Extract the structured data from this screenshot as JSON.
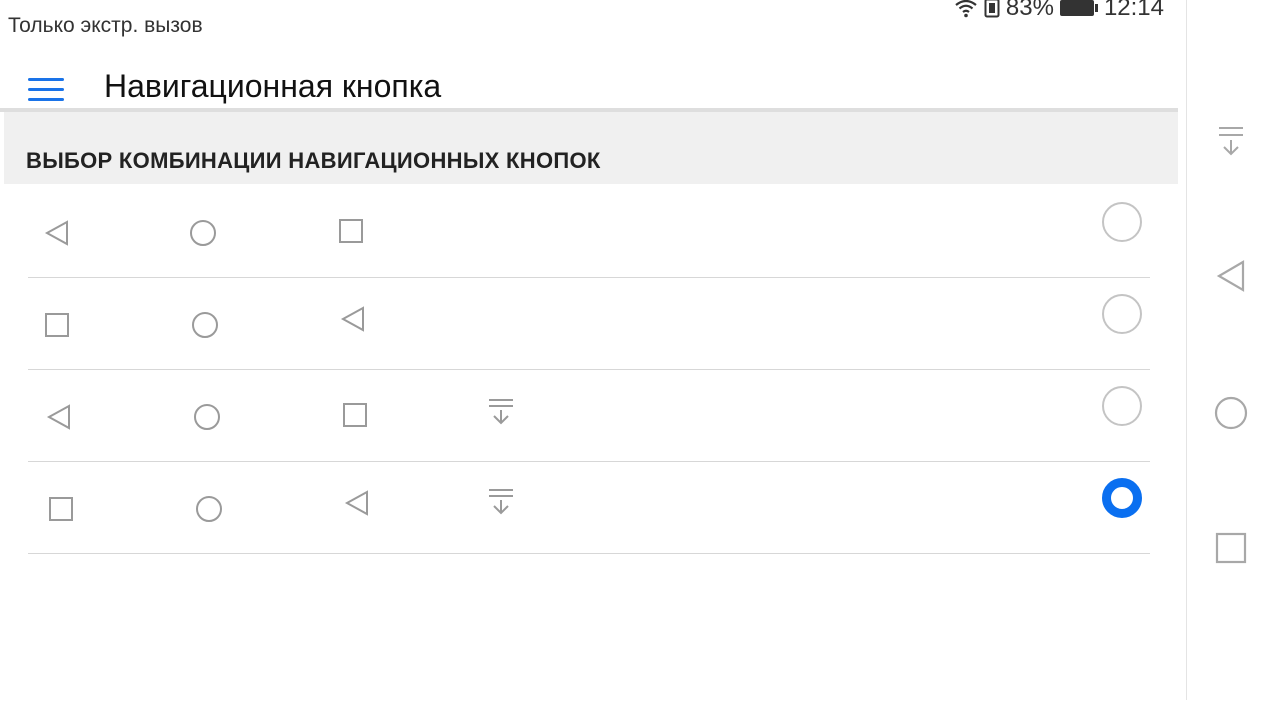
{
  "status_bar": {
    "carrier_text": "Только экстр. вызов",
    "battery_percent": "83%",
    "time": "12:14",
    "icons": [
      "wifi-icon",
      "sim-icon",
      "battery-icon"
    ]
  },
  "header": {
    "menu_icon": "hamburger-menu-icon",
    "title": "Навигационная кнопка"
  },
  "section": {
    "title": "ВЫБОР КОМБИНАЦИИ НАВИГАЦИОННЫХ КНОПОК"
  },
  "options": [
    {
      "buttons": [
        "back",
        "home",
        "recent"
      ],
      "selected": false
    },
    {
      "buttons": [
        "recent",
        "home",
        "back"
      ],
      "selected": false
    },
    {
      "buttons": [
        "back",
        "home",
        "recent",
        "notifications"
      ],
      "selected": false
    },
    {
      "buttons": [
        "recent",
        "home",
        "back",
        "notifications"
      ],
      "selected": true
    }
  ],
  "side_nav": {
    "buttons": [
      "notifications",
      "back",
      "home",
      "recent"
    ]
  },
  "colors": {
    "accent": "#0a6ff0",
    "icon_gray": "#9a9a9a",
    "side_icon_gray": "#a8a8a8"
  }
}
